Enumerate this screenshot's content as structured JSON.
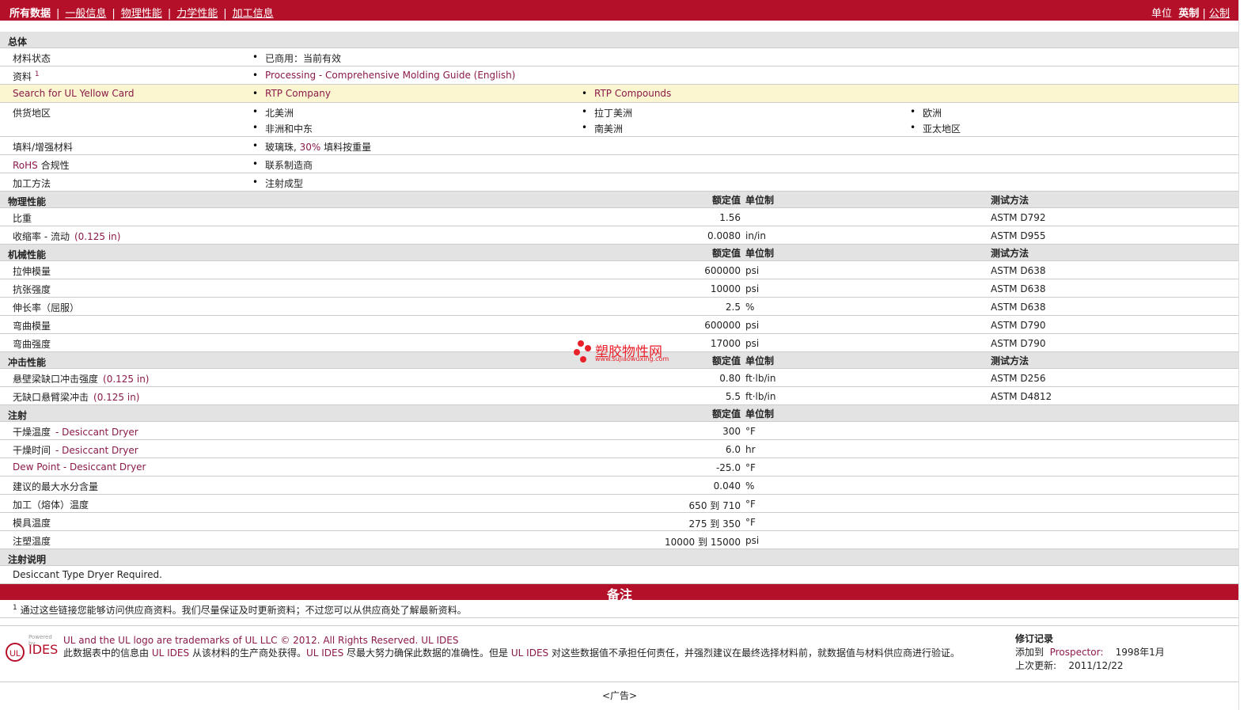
{
  "nav": {
    "active": "所有数据",
    "tabs": [
      "一般信息",
      "物理性能",
      "力学性能",
      "加工信息"
    ],
    "unit_label": "单位",
    "unit_on": "英制",
    "unit_off": "公制"
  },
  "general": {
    "title": "总体",
    "rows": {
      "status_label": "材料状态",
      "status_value": "已商用：当前有效",
      "resources_label": "资料",
      "resources_sup": "1",
      "resources_link": "Processing - Comprehensive Molding Guide (English)",
      "ul_label": "Search for UL Yellow Card",
      "ul_link1": "RTP Company",
      "ul_link2": "RTP Compounds",
      "region_label": "供货地区",
      "regions": [
        "北美洲",
        "拉丁美洲",
        "欧洲",
        "非洲和中东",
        "南美洲",
        "亚太地区"
      ],
      "filler_label": "填料/增强材料",
      "filler_value_a": "玻璃珠,",
      "filler_value_pct": "30%",
      "filler_value_b": "填料按重量",
      "rohs_label_a": "RoHS",
      "rohs_label_b": "合规性",
      "rohs_value": "联系制造商",
      "method_label": "加工方法",
      "method_value": "注射成型"
    }
  },
  "headers": {
    "nominal": "额定值",
    "unit": "单位制",
    "test": "测试方法"
  },
  "physical": {
    "title": "物理性能",
    "rows": [
      {
        "label": "比重",
        "note": "",
        "value": "1.56",
        "unit": "",
        "test": "ASTM D792"
      },
      {
        "label": "收缩率  - 流动",
        "note": "(0.125 in)",
        "value": "0.0080",
        "unit": "in/in",
        "test": "ASTM D955"
      }
    ]
  },
  "mechanical": {
    "title": "机械性能",
    "rows": [
      {
        "label": "拉伸模量",
        "value": "600000",
        "unit": "psi",
        "test": "ASTM D638"
      },
      {
        "label": "抗张强度",
        "value": "10000",
        "unit": "psi",
        "test": "ASTM D638"
      },
      {
        "label": "伸长率（屈服）",
        "value": "2.5",
        "unit": "%",
        "test": "ASTM D638"
      },
      {
        "label": "弯曲模量",
        "value": "600000",
        "unit": "psi",
        "test": "ASTM D790"
      },
      {
        "label": "弯曲强度",
        "value": "17000",
        "unit": "psi",
        "test": "ASTM D790"
      }
    ]
  },
  "impact": {
    "title": "冲击性能",
    "rows": [
      {
        "label": "悬壁梁缺口冲击强度",
        "note": "(0.125 in)",
        "value": "0.80",
        "unit": "ft·lb/in",
        "test": "ASTM D256"
      },
      {
        "label": "无缺口悬臂梁冲击",
        "note": "(0.125 in)",
        "value": "5.5",
        "unit": "ft·lb/in",
        "test": "ASTM D4812"
      }
    ]
  },
  "injection": {
    "title": "注射",
    "rows": [
      {
        "label": "干燥温度",
        "note": "- Desiccant Dryer",
        "value": "300",
        "unit": "°F"
      },
      {
        "label": "干燥时间",
        "note": "- Desiccant Dryer",
        "value": "6.0",
        "unit": "hr"
      },
      {
        "label": "",
        "note": "Dew Point - Desiccant Dryer",
        "value": "-25.0",
        "unit": "°F"
      },
      {
        "label": "建议的最大水分含量",
        "note": "",
        "value": "0.040",
        "unit": "%"
      },
      {
        "label": "加工（熔体）温度",
        "note": "",
        "value": "650 到  710",
        "unit": "°F"
      },
      {
        "label": "模具温度",
        "note": "",
        "value": "275 到  350",
        "unit": "°F"
      },
      {
        "label": "注塑温度",
        "note": "",
        "value": "10000 到  15000",
        "unit": "psi"
      }
    ]
  },
  "injection_notes": {
    "title": "注射说明",
    "text": "Desiccant Type Dryer Required."
  },
  "notes": {
    "title": "备注",
    "sup": "1",
    "text": "通过这些链接您能够访问供应商资料。我们尽量保证及时更新资料；不过您可以从供应商处了解最新资料。"
  },
  "watermark": {
    "cn": "塑胶物性网",
    "url": "www.sujiaowuxing.com"
  },
  "footer": {
    "logo_small": "Powered by",
    "logo_big": "IDES",
    "trademark": "UL and the UL logo are trademarks of UL LLC © 2012. All Rights Reserved.",
    "trademark_link": "UL IDES",
    "disclaimer_a": "此数据表中的信息由",
    "disclaimer_link1": "UL IDES",
    "disclaimer_b": "从该材料的生产商处获得。",
    "disclaimer_link2": "UL IDES",
    "disclaimer_c": "尽最大努力确保此数据的准确性。但是",
    "disclaimer_link3": "UL IDES",
    "disclaimer_d": "对这些数据值不承担任何责任，并强烈建议在最终选择材料前，就数据值与材料供应商进行验证。",
    "rev_title": "修订记录",
    "added_label": "添加到",
    "added_link": "Prospector:",
    "added_date": "1998年1月",
    "updated_label": "上次更新:",
    "updated_date": "2011/12/22"
  },
  "ad": "<广告>",
  "colors": {
    "brand_red": "#b5102a",
    "link": "#8b1a4a",
    "yellow_row": "#fbf6cf",
    "section_gray": "#e3e3e3"
  }
}
